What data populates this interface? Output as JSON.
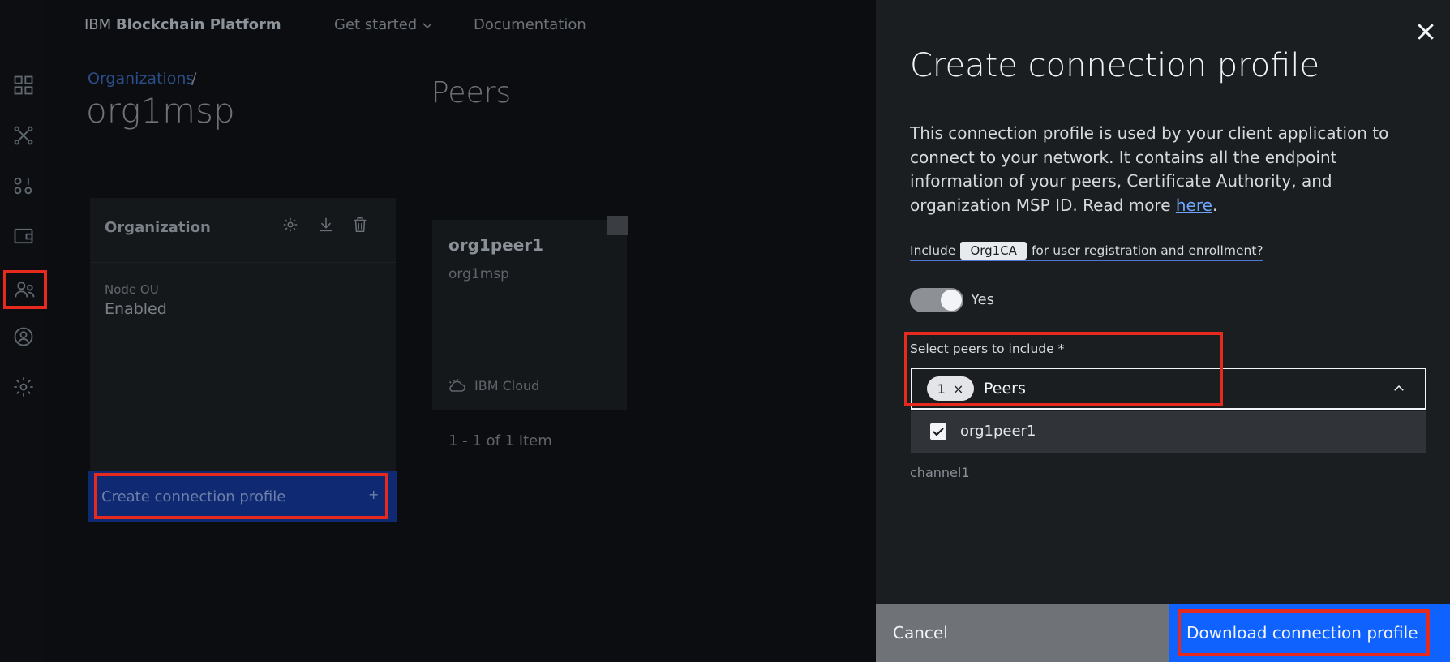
{
  "header": {
    "brand_prefix": "IBM",
    "brand_name": "Blockchain Platform",
    "nav": {
      "get_started": "Get started",
      "documentation": "Documentation"
    }
  },
  "sidebar": {
    "items": [
      {
        "icon": "dashboard-grid-icon"
      },
      {
        "icon": "network-nodes-icon"
      },
      {
        "icon": "binary-icon"
      },
      {
        "icon": "wallet-icon"
      },
      {
        "icon": "users-icon",
        "active": true
      },
      {
        "icon": "user-circle-icon"
      },
      {
        "icon": "settings-gear-icon"
      }
    ]
  },
  "breadcrumb": {
    "parent": "Organizations",
    "separator": "/"
  },
  "page_title": "org1msp",
  "peers_section": {
    "title": "Peers",
    "card": {
      "name": "org1peer1",
      "org": "org1msp",
      "location": "IBM Cloud"
    },
    "pagination": "1 - 1 of 1 Item"
  },
  "organization_card": {
    "title": "Organization",
    "node_ou_label": "Node OU",
    "node_ou_value": "Enabled",
    "create_profile_label": "Create connection profile",
    "create_profile_icon": "+"
  },
  "panel": {
    "title": "Create connection profile",
    "description_text": "This connection profile is used by your client application to connect to your network. It contains all the endpoint information of your peers, Certificate Authority, and organization MSP ID. Read more ",
    "description_link": "here",
    "description_end": ".",
    "include_prefix": "Include",
    "include_ca": "Org1CA",
    "include_suffix": "for user registration and enrollment?",
    "toggle_label": "Yes",
    "select_label": "Select peers to include *",
    "select_count": "1",
    "select_chip_close": "×",
    "select_placeholder": "Peers",
    "options": [
      {
        "label": "org1peer1",
        "checked": true
      }
    ],
    "channel": "channel1",
    "cancel_label": "Cancel",
    "download_label": "Download connection profile"
  },
  "colors": {
    "highlight": "#e62b1e",
    "primary_button": "#0f62fe",
    "panel_bg": "#1b1e21"
  }
}
